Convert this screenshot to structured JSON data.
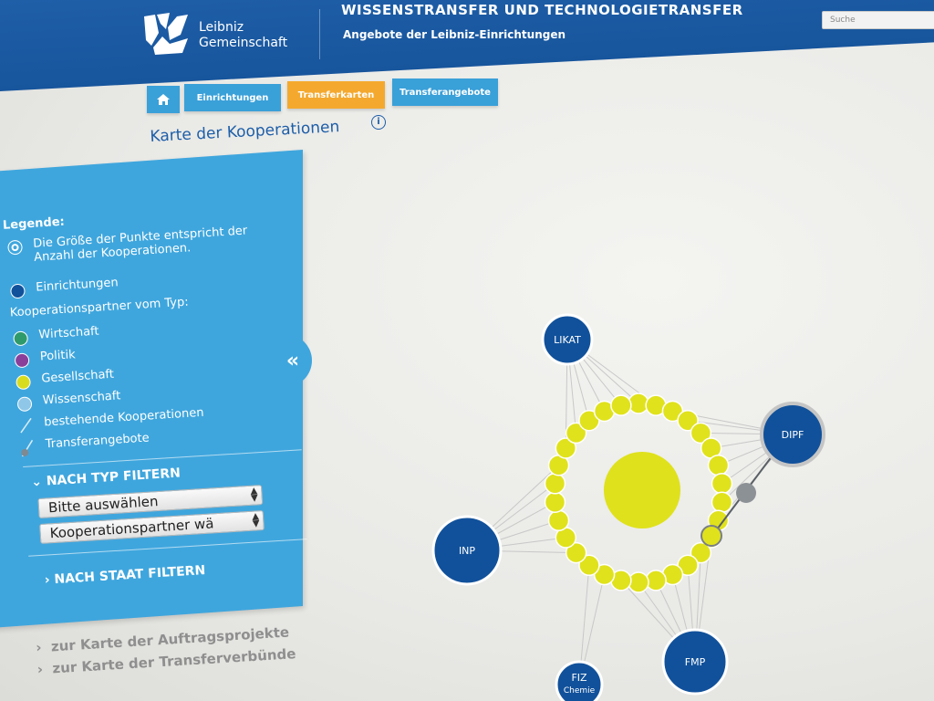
{
  "header": {
    "logo_line1": "Leibniz",
    "logo_line2": "Gemeinschaft",
    "title": "WISSENSTRANSFER UND TECHNOLOGIETRANSFER",
    "subtitle": "Angebote der Leibniz-Einrichtungen",
    "search_placeholder": "Suche"
  },
  "nav": {
    "home_icon": "home-icon",
    "tabs": [
      {
        "label": "Einrichtungen",
        "active": false
      },
      {
        "label": "Transferkarten",
        "active": true
      },
      {
        "label": "Transferangebote",
        "active": false
      }
    ]
  },
  "page": {
    "title": "Karte der Kooperationen",
    "info_icon": "ⓘ"
  },
  "legend": {
    "title": "Legende:",
    "size_note": "Die Größe der Punkte entspricht der Anzahl der Kooperationen.",
    "einrichtungen": "Einrichtungen",
    "partner_type_heading": "Kooperationspartner vom Typ:",
    "types": [
      {
        "label": "Wirtschaft",
        "color": "#2f9a6b"
      },
      {
        "label": "Politik",
        "color": "#8a3f9a"
      },
      {
        "label": "Gesellschaft",
        "color": "#d8dc1f"
      },
      {
        "label": "Wissenschaft",
        "color": "#8fc7e8"
      }
    ],
    "existing": "bestehende Kooperationen",
    "transfer": "Transferangebote",
    "institution_color": "#11519b"
  },
  "filters": {
    "by_type": "NACH TYP FILTERN",
    "select1": "Bitte auswählen",
    "select2": "Kooperationspartner wä",
    "by_state": "NACH STAAT FILTERN"
  },
  "links": {
    "auftrag": "zur Karte der Auftragsprojekte",
    "verbund": "zur Karte der Transferverbünde"
  },
  "network": {
    "institutions": [
      "LIKAT",
      "DIPF",
      "INP",
      "FMP",
      "FIZ",
      "Chemie"
    ],
    "partner_color": "#e0e21c",
    "institution_color": "#11519b"
  }
}
